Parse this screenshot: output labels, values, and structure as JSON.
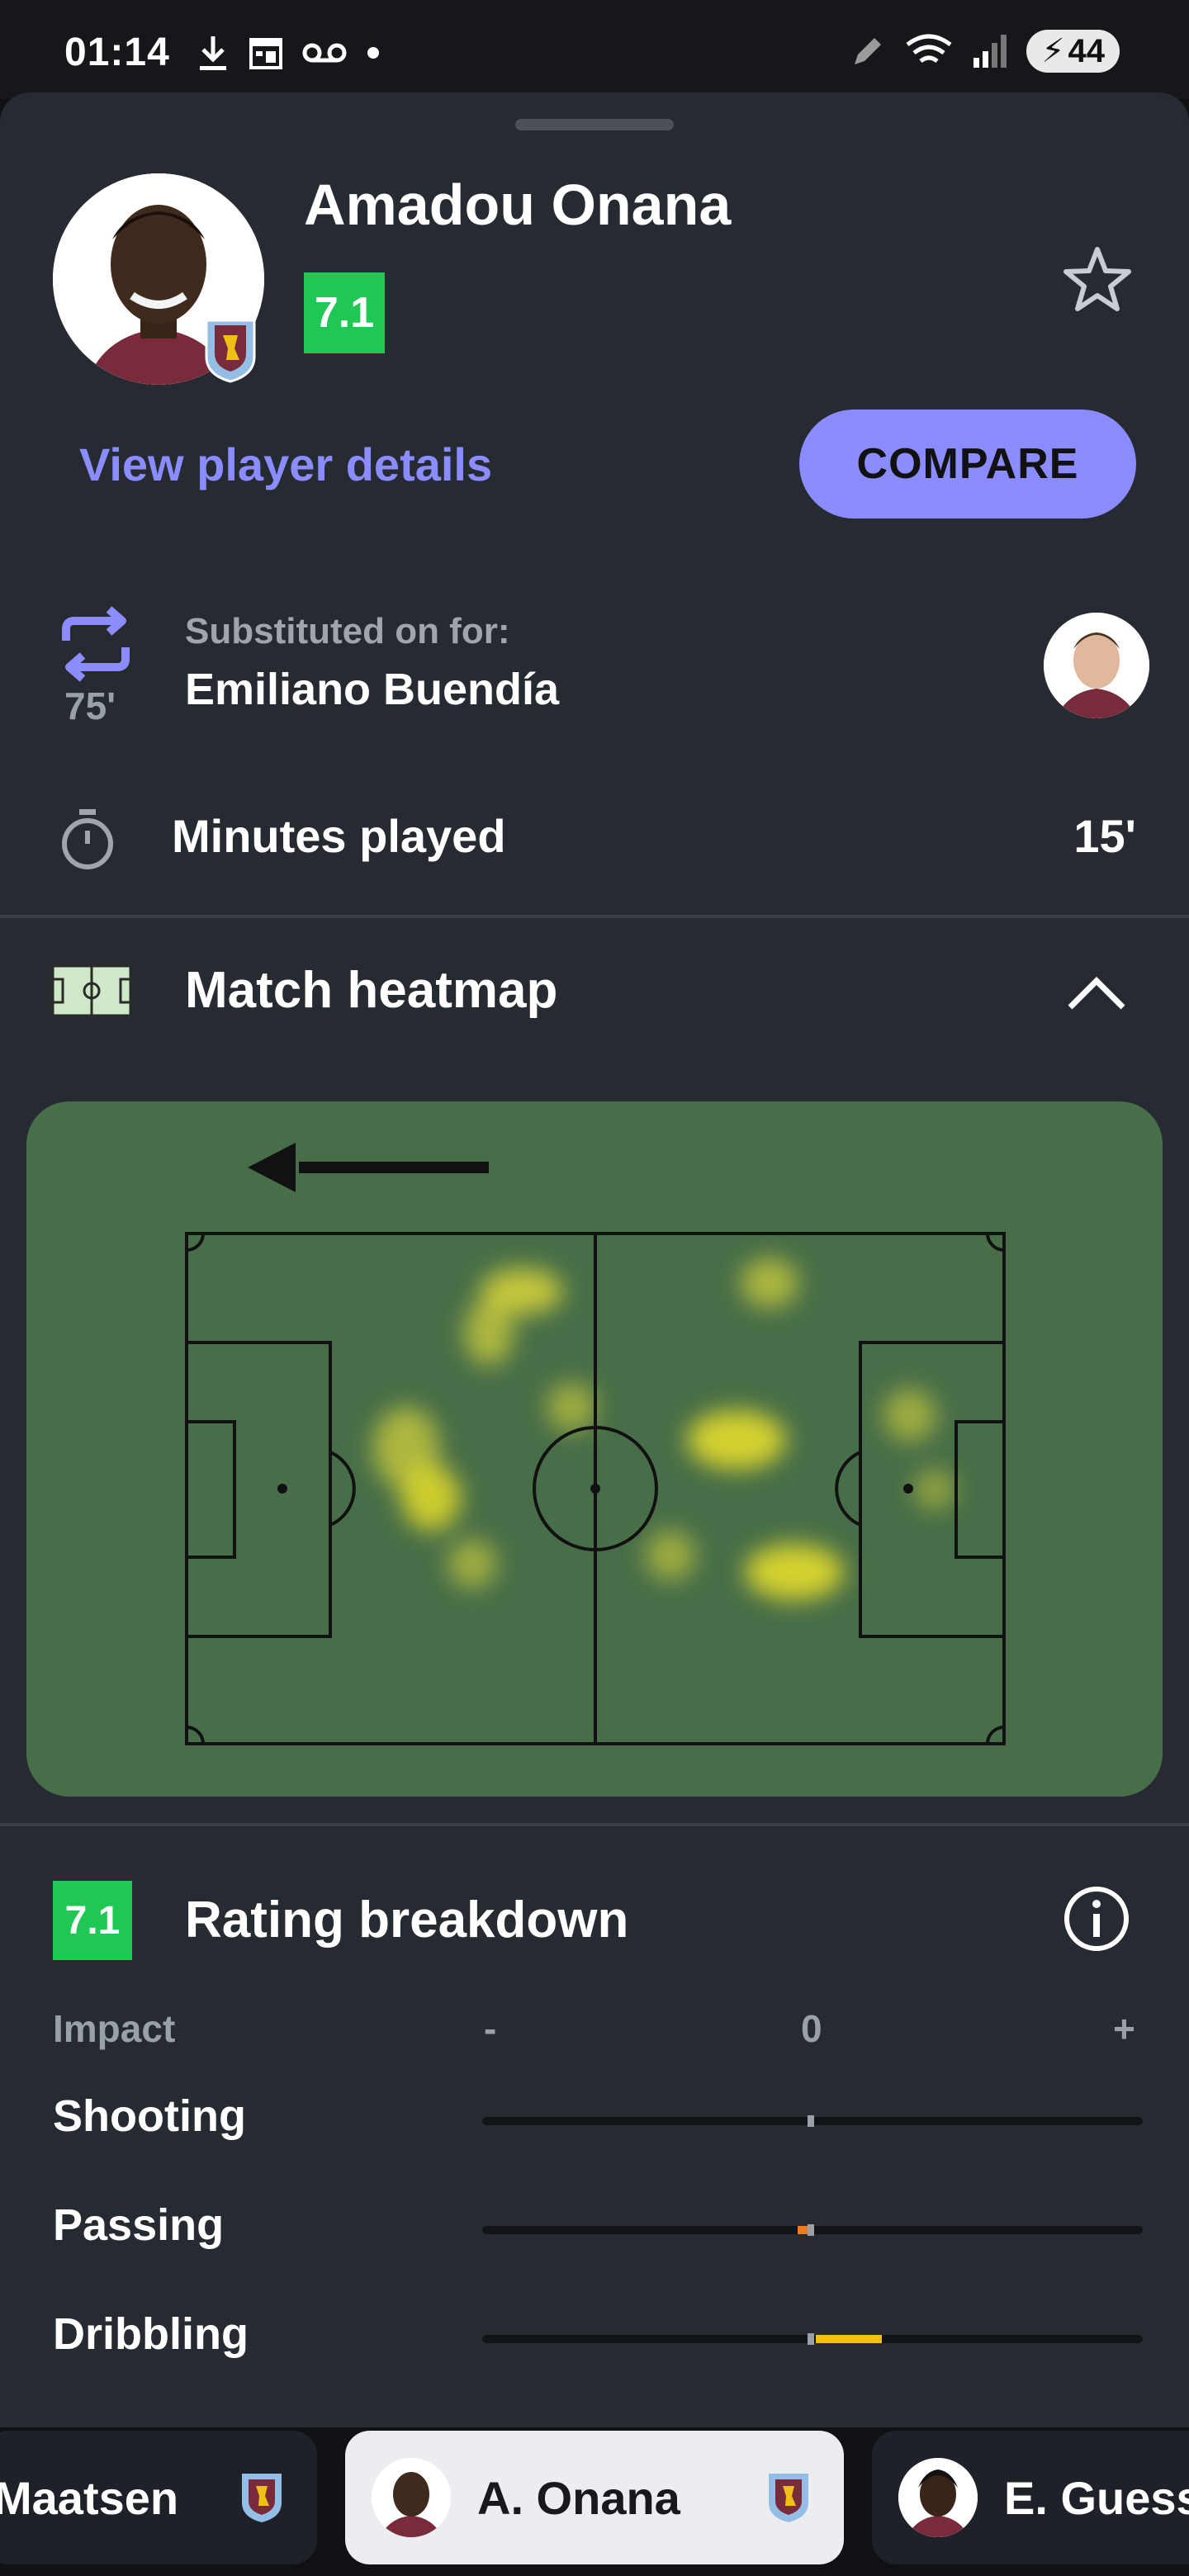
{
  "status_bar": {
    "time": "01:14",
    "battery": "44",
    "left_icons": [
      "download-icon",
      "calendar-icon",
      "voicemail-icon",
      "dot-icon"
    ],
    "right_icons": [
      "edit-icon",
      "wifi-icon",
      "signal-icon",
      "battery-icon"
    ]
  },
  "player": {
    "name": "Amadou Onana",
    "rating": "7.1",
    "rating_color": "#1ec853",
    "view_details_label": "View player details",
    "compare_label": "COMPARE"
  },
  "substitution": {
    "minute": "75'",
    "caption": "Substituted on for:",
    "replaced_player": "Emiliano Buendía"
  },
  "minutes": {
    "label": "Minutes played",
    "value": "15'"
  },
  "heatmap": {
    "title": "Match heatmap",
    "attack_direction": "left"
  },
  "breakdown": {
    "title": "Rating breakdown",
    "rating": "7.1",
    "impact_label": "Impact",
    "axis_minus": "-",
    "axis_zero": "0",
    "axis_plus": "+",
    "categories": [
      {
        "label": "Shooting",
        "impact": 0.0,
        "color": "#9aa0a8"
      },
      {
        "label": "Passing",
        "impact": -0.03,
        "color": "#f07b1e"
      },
      {
        "label": "Dribbling",
        "impact": 0.2,
        "color": "#f2c014"
      }
    ]
  },
  "carousel": {
    "players": [
      {
        "name": "Maatsen",
        "active": false
      },
      {
        "name": "A. Onana",
        "active": true
      },
      {
        "name": "E. Guess",
        "active": false
      }
    ]
  },
  "colors": {
    "accent": "#8a8cff",
    "sheet_background": "#262a31",
    "pitch": "#476e48"
  }
}
